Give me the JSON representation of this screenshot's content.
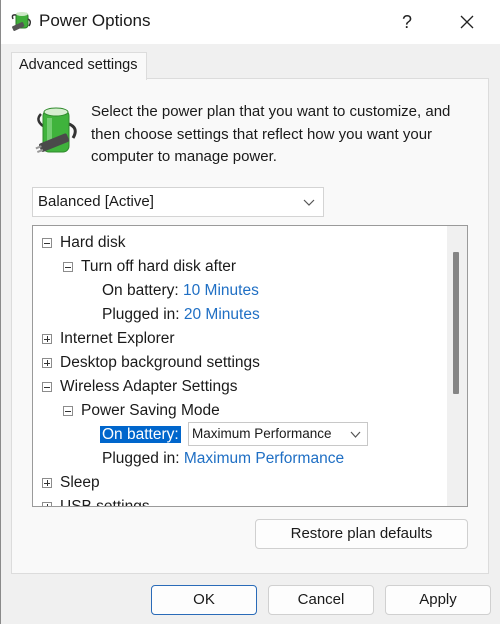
{
  "window": {
    "title": "Power Options",
    "help_label": "?",
    "close_label": "Close"
  },
  "tabs": [
    {
      "label": "Advanced settings",
      "active": true
    }
  ],
  "description": "Select the power plan that you want to customize, and then choose settings that reflect how you want your computer to manage power.",
  "plan_select": {
    "value": "Balanced [Active]"
  },
  "tree": {
    "rows": [
      {
        "label": "Hard disk",
        "expander": "minus",
        "level": 0
      },
      {
        "label": "Turn off hard disk after",
        "expander": "minus",
        "level": 1
      },
      {
        "label": "On battery:",
        "value": "10 Minutes",
        "level": 2
      },
      {
        "label": "Plugged in:",
        "value": "20 Minutes",
        "level": 2
      },
      {
        "label": "Internet Explorer",
        "expander": "plus",
        "level": 0
      },
      {
        "label": "Desktop background settings",
        "expander": "plus",
        "level": 0
      },
      {
        "label": "Wireless Adapter Settings",
        "expander": "minus",
        "level": 0
      },
      {
        "label": "Power Saving Mode",
        "expander": "minus",
        "level": 1
      },
      {
        "label": "On battery:",
        "value": "Maximum Performance",
        "level": 2,
        "selected": true,
        "editing": true
      },
      {
        "label": "Plugged in:",
        "value": "Maximum Performance",
        "level": 2
      },
      {
        "label": "Sleep",
        "expander": "plus",
        "level": 0
      },
      {
        "label": "USB settings",
        "expander": "plus",
        "level": 0
      }
    ]
  },
  "buttons": {
    "restore": "Restore plan defaults",
    "ok": "OK",
    "cancel": "Cancel",
    "apply": "Apply"
  },
  "colors": {
    "link": "#1f6fc4",
    "selection": "#0066cc",
    "default_button_border": "#2a6bb8"
  }
}
